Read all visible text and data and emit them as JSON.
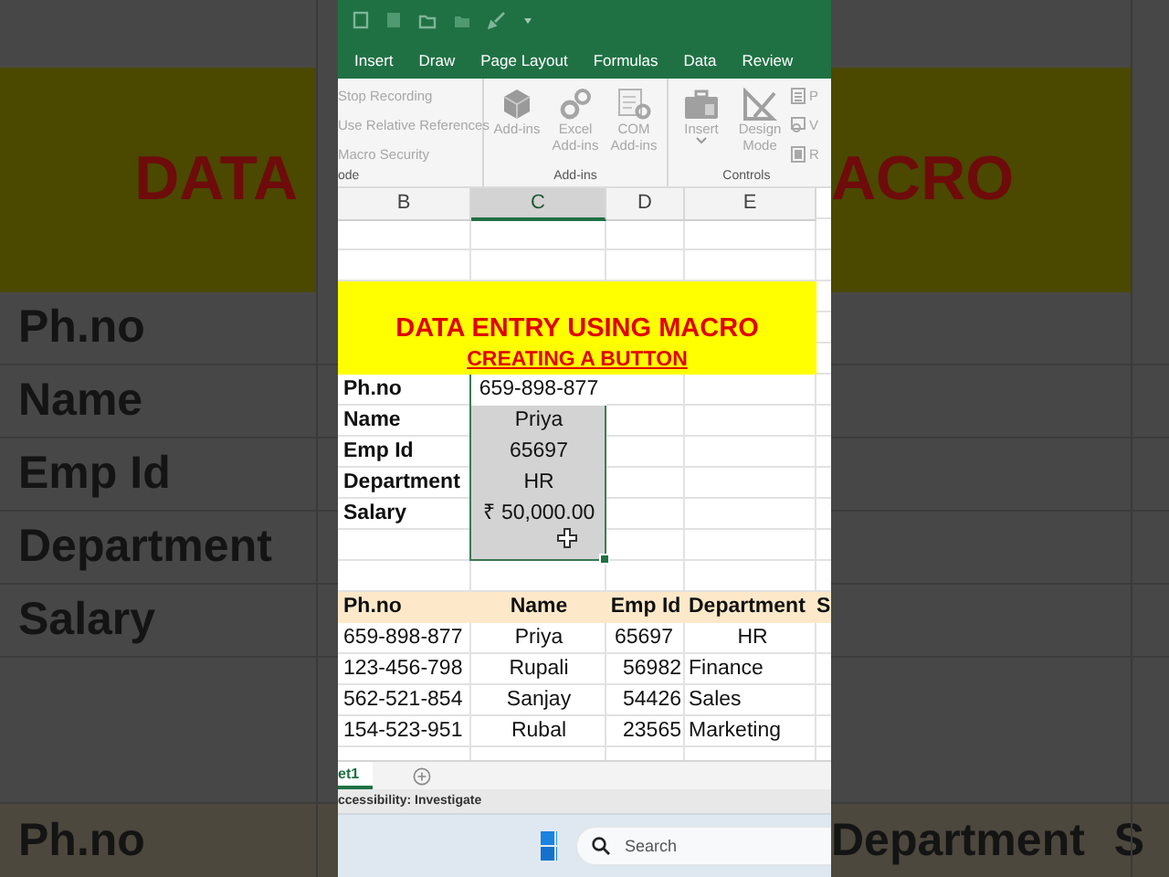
{
  "backdrop_left": {
    "banner_text": "DATA",
    "labels": [
      "Ph.no",
      "Name",
      "Emp Id",
      "Department",
      "Salary"
    ],
    "table_headers": [
      "Ph.no"
    ]
  },
  "backdrop_right": {
    "banner_text": "ACRO",
    "table_headers": [
      "Department",
      "S"
    ]
  },
  "ribbon_tabs": [
    "Insert",
    "Draw",
    "Page Layout",
    "Formulas",
    "Data",
    "Review"
  ],
  "ribbon_groups": [
    {
      "label": "ode",
      "items": [
        {
          "kind": "small",
          "label": "Stop Recording"
        },
        {
          "kind": "small",
          "label": "Use Relative References"
        },
        {
          "kind": "small",
          "label": "Macro Security"
        }
      ]
    },
    {
      "label": "Add-ins",
      "items": [
        {
          "kind": "large",
          "label": "Add-ins",
          "dropdown": false
        },
        {
          "kind": "large",
          "label": "Excel Add-ins",
          "dropdown": false
        },
        {
          "kind": "large",
          "label": "COM Add-ins",
          "dropdown": false
        }
      ]
    },
    {
      "label": "Controls",
      "items": [
        {
          "kind": "large",
          "label": "Insert",
          "dropdown": true
        },
        {
          "kind": "large",
          "label": "Design Mode",
          "dropdown": false
        },
        {
          "kind": "compact",
          "label": "P"
        },
        {
          "kind": "compact",
          "label": "V"
        },
        {
          "kind": "compact",
          "label": "R"
        }
      ]
    }
  ],
  "sheet": {
    "columns": [
      {
        "label": "B",
        "selected": false
      },
      {
        "label": "C",
        "selected": true
      },
      {
        "label": "D",
        "selected": false
      },
      {
        "label": "E",
        "selected": false
      }
    ],
    "title": "DATA ENTRY USING MACRO",
    "subtitle": "CREATING A BUTTON",
    "form": [
      {
        "label": "Ph.no",
        "value": "659-898-877",
        "active": true
      },
      {
        "label": "Name",
        "value": "Priya",
        "active": false
      },
      {
        "label": "Emp Id",
        "value": "65697",
        "active": false
      },
      {
        "label": "Department",
        "value": "HR",
        "active": false
      },
      {
        "label": "Salary",
        "value": "₹ 50,000.00",
        "active": false
      }
    ],
    "table": {
      "columns": [
        "Ph.no",
        "Name",
        "Emp Id",
        "Department",
        "S"
      ],
      "rows": [
        [
          "659-898-877",
          "Priya",
          "65697",
          "HR"
        ],
        [
          "123-456-798",
          "Rupali",
          "56982",
          "Finance"
        ],
        [
          "562-521-854",
          "Sanjay",
          "54426",
          "Sales"
        ],
        [
          "154-523-951",
          "Rubal",
          "23565",
          "Marketing"
        ]
      ]
    }
  },
  "sheet_tabs": [
    {
      "label": "et1",
      "selected": true
    }
  ],
  "status_bar": "ccessibility: Investigate",
  "taskbar": {
    "search": {
      "placeholder": "Search"
    }
  }
}
